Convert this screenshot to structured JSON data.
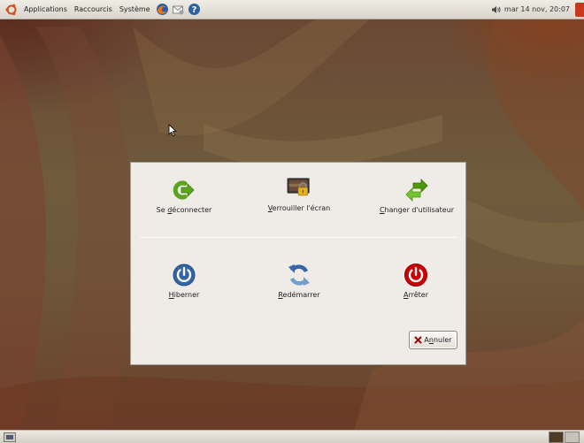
{
  "top_panel": {
    "menus": [
      "Applications",
      "Raccourcis",
      "Système"
    ],
    "clock": "mar 14 nov, 20:07"
  },
  "dialog": {
    "actions": [
      {
        "pre": "Se ",
        "key": "d",
        "post": "éconnecter",
        "icon": "logout-arrow-icon"
      },
      {
        "pre": "",
        "key": "V",
        "post": "errouiller l'écran",
        "icon": "lock-screen-icon"
      },
      {
        "pre": "",
        "key": "C",
        "post": "hanger d'utilisateur",
        "icon": "switch-user-icon"
      },
      {
        "pre": "",
        "key": "H",
        "post": "iberner",
        "icon": "hibernate-icon"
      },
      {
        "pre": "",
        "key": "R",
        "post": "edémarrer",
        "icon": "restart-icon"
      },
      {
        "pre": "",
        "key": "A",
        "post": "rrêter",
        "icon": "shutdown-icon"
      }
    ],
    "cancel": {
      "pre": "A",
      "key": "n",
      "post": "nuler"
    }
  },
  "colors": {
    "panel": "#dcd8cf",
    "dialog_bg": "#efebe7",
    "logout_green": "#5aa51d",
    "switch_green": "#4e9a06",
    "blue": "#3465a4",
    "shutdown_red": "#cc0000"
  }
}
